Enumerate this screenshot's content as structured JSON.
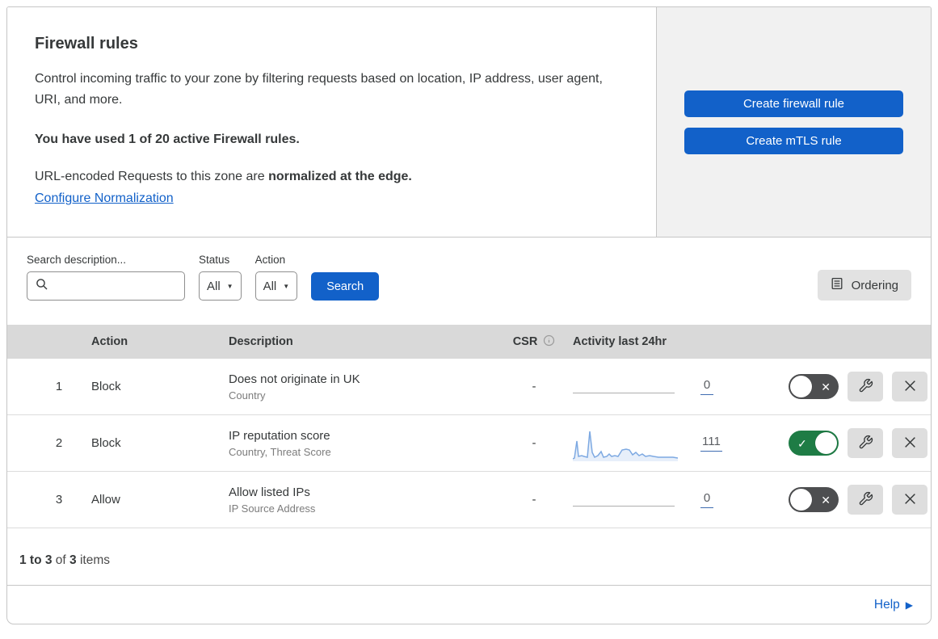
{
  "colors": {
    "accent": "#1261c9",
    "panel_bg": "#f1f1f1",
    "thead_bg": "#d9d9d9",
    "toggle_on": "#1e7c45",
    "toggle_off": "#4d4e50",
    "spark_line": "#7da9e2",
    "spark_fill": "#e7effa",
    "flat_line": "#aeaeae"
  },
  "header": {
    "title": "Firewall rules",
    "description": "Control incoming traffic to your zone by filtering requests based on location, IP address, user agent, URI, and more.",
    "usage_bold": "You have used 1 of 20 active Firewall rules.",
    "normalization_prefix": "URL-encoded Requests to this zone are ",
    "normalization_bold": "normalized at the edge.",
    "normalization_link": "Configure Normalization"
  },
  "actions_panel": {
    "create_firewall_label": "Create firewall rule",
    "create_mtls_label": "Create mTLS rule"
  },
  "filters": {
    "search_label": "Search description...",
    "search_value": "",
    "status_label": "Status",
    "status_value": "All",
    "action_label": "Action",
    "action_value": "All",
    "search_button": "Search",
    "ordering_button": "Ordering"
  },
  "table": {
    "headers": {
      "action": "Action",
      "description": "Description",
      "csr": "CSR",
      "activity": "Activity last 24hr"
    },
    "rows": [
      {
        "num": "1",
        "action": "Block",
        "description": "Does not originate in UK",
        "criteria": "Country",
        "csr": "-",
        "activity_count": "0",
        "enabled": false
      },
      {
        "num": "2",
        "action": "Block",
        "description": "IP reputation score",
        "criteria": "Country, Threat Score",
        "csr": "-",
        "activity_count": "111",
        "enabled": true,
        "sparkline": [
          [
            0,
            41
          ],
          [
            2,
            40
          ],
          [
            5,
            19
          ],
          [
            7,
            38
          ],
          [
            11,
            37
          ],
          [
            14,
            38
          ],
          [
            18,
            39
          ],
          [
            21,
            7
          ],
          [
            24,
            33
          ],
          [
            27,
            39
          ],
          [
            31,
            37
          ],
          [
            35,
            32
          ],
          [
            38,
            39
          ],
          [
            42,
            38
          ],
          [
            45,
            35
          ],
          [
            48,
            38
          ],
          [
            52,
            37
          ],
          [
            56,
            38
          ],
          [
            61,
            30
          ],
          [
            66,
            29
          ],
          [
            70,
            30
          ],
          [
            74,
            36
          ],
          [
            78,
            33
          ],
          [
            82,
            37
          ],
          [
            86,
            35
          ],
          [
            90,
            38
          ],
          [
            95,
            37
          ],
          [
            100,
            38
          ],
          [
            106,
            39
          ],
          [
            112,
            39
          ],
          [
            118,
            39
          ],
          [
            124,
            39
          ],
          [
            130,
            40
          ]
        ]
      },
      {
        "num": "3",
        "action": "Allow",
        "description": "Allow listed IPs",
        "criteria": "IP Source Address",
        "csr": "-",
        "activity_count": "0",
        "enabled": false
      }
    ]
  },
  "footer": {
    "range_bold": "1 to 3",
    "of_text": " of ",
    "total_bold": "3",
    "items_text": " items"
  },
  "help": {
    "label": "Help"
  },
  "icons": {
    "caret": "▼",
    "check": "✓",
    "cross": "✕",
    "help_arrow": "▶"
  }
}
